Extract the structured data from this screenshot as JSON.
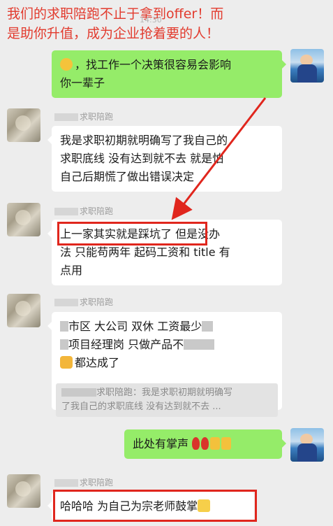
{
  "banner": {
    "line1": "我们的求职陪跑不止于拿到offer！而",
    "line2": "是助你升值，成为企业抢着要的人！"
  },
  "timestamp": "14:30",
  "colors": {
    "accent_red": "#e0261d",
    "self_bubble": "#95ec69",
    "banner_text": "#e23b2e"
  },
  "messages": [
    {
      "side": "right",
      "sender": "",
      "lines": [
        "，找工作一个决策很容易会影响",
        "你一辈子"
      ],
      "emoji": "sweat-smile-emoji"
    },
    {
      "side": "left",
      "sender": "求职陪跑",
      "lines": [
        "我是求职初期就明确写了我自己的",
        "求职底线 没有达到就不去 就是怕",
        "自己后期慌了做出错误决定"
      ]
    },
    {
      "side": "left",
      "sender": "求职陪跑",
      "lines": [
        "上一家其实就是踩坑了 但是没办",
        "法 只能苟两年 起码工资和 title 有",
        "点用"
      ],
      "highlight": "上一家其实就是踩坑了"
    },
    {
      "side": "left",
      "sender": "求职陪跑",
      "line1": "市区 大公司 双休 工资最少",
      "line2": "项目经理岗 只做产品不",
      "line3": "都达成了",
      "quote_line1": "求职陪跑：我是求职初期就明确写",
      "quote_line2": "了我自己的求职底线 没有达到就不去 ..."
    },
    {
      "side": "right",
      "text": "此处有掌声",
      "emoji": [
        "rose-emoji",
        "rose-emoji",
        "thumbs-up-emoji",
        "thumbs-up-emoji"
      ]
    },
    {
      "side": "left",
      "sender": "求职陪跑",
      "text": "哈哈哈 为自己为宗老师鼓掌",
      "emoji": "clap-emoji"
    }
  ]
}
